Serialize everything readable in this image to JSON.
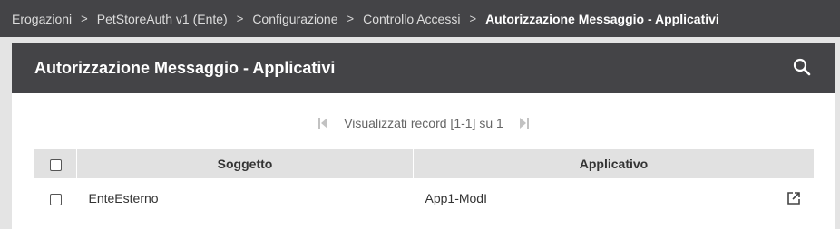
{
  "breadcrumb": {
    "items": [
      "Erogazioni",
      "PetStoreAuth v1 (Ente)",
      "Configurazione",
      "Controllo Accessi"
    ],
    "current": "Autorizzazione Messaggio - Applicativi",
    "separator": ">"
  },
  "panel": {
    "title": "Autorizzazione Messaggio - Applicativi",
    "search_icon": "search-icon"
  },
  "pager": {
    "text": "Visualizzati record [1-1] su 1",
    "first_icon": "first-page-icon",
    "last_icon": "last-page-icon"
  },
  "table": {
    "columns": [
      "Soggetto",
      "Applicativo"
    ],
    "rows": [
      {
        "soggetto": "EnteEsterno",
        "applicativo": "App1-ModI",
        "action_icon": "open-external-icon"
      }
    ]
  },
  "colors": {
    "header_bg": "#444447",
    "page_bg": "#e4e4e4",
    "table_header_bg": "#e1e1e1"
  }
}
